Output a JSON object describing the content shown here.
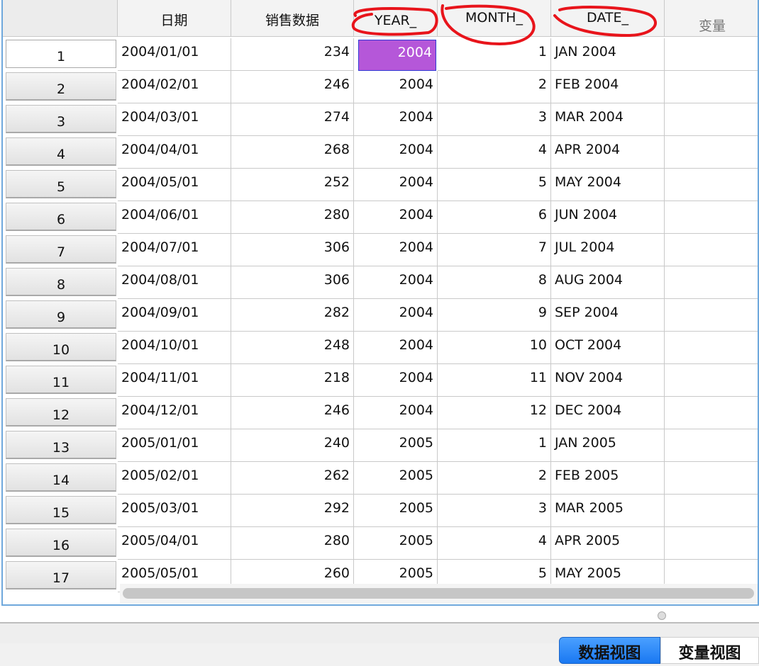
{
  "columns": [
    "日期",
    "销售数据",
    "YEAR_",
    "MONTH_",
    "DATE_",
    "变量"
  ],
  "rows": [
    {
      "n": "1",
      "date": "2004/01/01",
      "sales": "234",
      "year": "2004",
      "month": "1",
      "label": "JAN 2004"
    },
    {
      "n": "2",
      "date": "2004/02/01",
      "sales": "246",
      "year": "2004",
      "month": "2",
      "label": "FEB 2004"
    },
    {
      "n": "3",
      "date": "2004/03/01",
      "sales": "274",
      "year": "2004",
      "month": "3",
      "label": "MAR 2004"
    },
    {
      "n": "4",
      "date": "2004/04/01",
      "sales": "268",
      "year": "2004",
      "month": "4",
      "label": "APR 2004"
    },
    {
      "n": "5",
      "date": "2004/05/01",
      "sales": "252",
      "year": "2004",
      "month": "5",
      "label": "MAY 2004"
    },
    {
      "n": "6",
      "date": "2004/06/01",
      "sales": "280",
      "year": "2004",
      "month": "6",
      "label": "JUN 2004"
    },
    {
      "n": "7",
      "date": "2004/07/01",
      "sales": "306",
      "year": "2004",
      "month": "7",
      "label": "JUL 2004"
    },
    {
      "n": "8",
      "date": "2004/08/01",
      "sales": "306",
      "year": "2004",
      "month": "8",
      "label": "AUG 2004"
    },
    {
      "n": "9",
      "date": "2004/09/01",
      "sales": "282",
      "year": "2004",
      "month": "9",
      "label": "SEP 2004"
    },
    {
      "n": "10",
      "date": "2004/10/01",
      "sales": "248",
      "year": "2004",
      "month": "10",
      "label": "OCT 2004"
    },
    {
      "n": "11",
      "date": "2004/11/01",
      "sales": "218",
      "year": "2004",
      "month": "11",
      "label": "NOV 2004"
    },
    {
      "n": "12",
      "date": "2004/12/01",
      "sales": "246",
      "year": "2004",
      "month": "12",
      "label": "DEC 2004"
    },
    {
      "n": "13",
      "date": "2005/01/01",
      "sales": "240",
      "year": "2005",
      "month": "1",
      "label": "JAN 2005"
    },
    {
      "n": "14",
      "date": "2005/02/01",
      "sales": "262",
      "year": "2005",
      "month": "2",
      "label": "FEB 2005"
    },
    {
      "n": "15",
      "date": "2005/03/01",
      "sales": "292",
      "year": "2005",
      "month": "3",
      "label": "MAR 2005"
    },
    {
      "n": "16",
      "date": "2005/04/01",
      "sales": "280",
      "year": "2005",
      "month": "4",
      "label": "APR 2005"
    },
    {
      "n": "17",
      "date": "2005/05/01",
      "sales": "260",
      "year": "2005",
      "month": "5",
      "label": "MAY 2005"
    }
  ],
  "selected": {
    "row": 0,
    "col": "year"
  },
  "active_row": 0,
  "tabs": {
    "data_view": "数据视图",
    "variable_view": "变量视图"
  },
  "colors": {
    "selection": "#b557d9",
    "accent": "#1a78f2",
    "annotation": "#e8141b"
  }
}
